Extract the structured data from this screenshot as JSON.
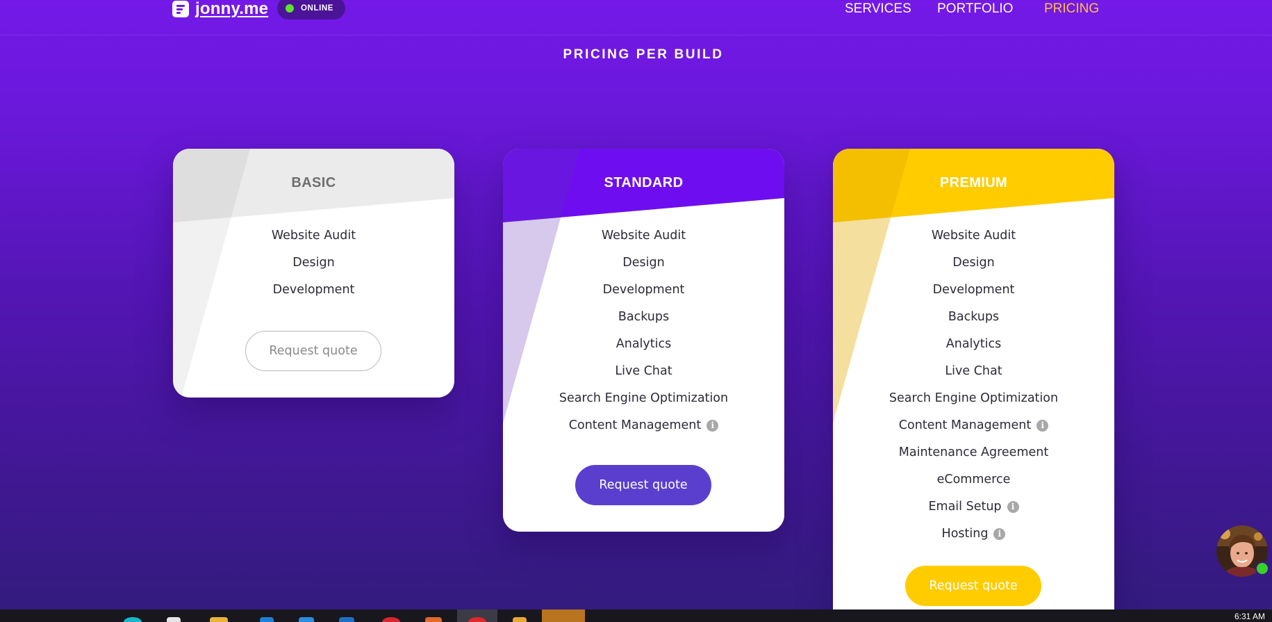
{
  "brand": {
    "name": "jonny.me",
    "status": "ONLINE"
  },
  "nav": {
    "items": [
      "SERVICES",
      "PORTFOLIO",
      "PRICING"
    ],
    "active": "PRICING"
  },
  "section_title": "PRICING PER BUILD",
  "colors": {
    "accent_orange": "#ffc23d",
    "standard_purple": "#6e0ef0",
    "premium_yellow": "#ffcc00",
    "standard_button": "#5a3fcf"
  },
  "plans": [
    {
      "name": "BASIC",
      "features": [
        {
          "label": "Website Audit",
          "info": false
        },
        {
          "label": "Design",
          "info": false
        },
        {
          "label": "Development",
          "info": false
        }
      ],
      "button": "Request quote"
    },
    {
      "name": "STANDARD",
      "features": [
        {
          "label": "Website Audit",
          "info": false
        },
        {
          "label": "Design",
          "info": false
        },
        {
          "label": "Development",
          "info": false
        },
        {
          "label": "Backups",
          "info": false
        },
        {
          "label": "Analytics",
          "info": false
        },
        {
          "label": "Live Chat",
          "info": false
        },
        {
          "label": "Search Engine Optimization",
          "info": false
        },
        {
          "label": "Content Management",
          "info": true
        }
      ],
      "button": "Request quote"
    },
    {
      "name": "PREMIUM",
      "features": [
        {
          "label": "Website Audit",
          "info": false
        },
        {
          "label": "Design",
          "info": false
        },
        {
          "label": "Development",
          "info": false
        },
        {
          "label": "Backups",
          "info": false
        },
        {
          "label": "Analytics",
          "info": false
        },
        {
          "label": "Live Chat",
          "info": false
        },
        {
          "label": "Search Engine Optimization",
          "info": false
        },
        {
          "label": "Content Management",
          "info": true
        },
        {
          "label": "Maintenance Agreement",
          "info": false
        },
        {
          "label": "eCommerce",
          "info": false
        },
        {
          "label": "Email Setup",
          "info": true
        },
        {
          "label": "Hosting",
          "info": true
        }
      ],
      "button": "Request quote"
    }
  ],
  "chat": {
    "status": "online"
  },
  "taskbar": {
    "clock": "6:31 AM"
  }
}
